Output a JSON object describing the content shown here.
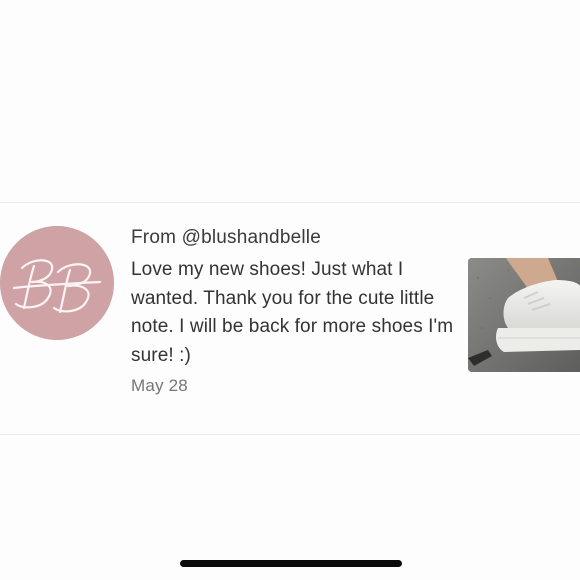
{
  "review": {
    "avatar_monogram": "BB",
    "author": "From @blushandbelle",
    "text": "Love my new shoes! Just what I wanted. Thank you for the cute little note. I will be back for more shoes I'm sure! :)",
    "date": "May 28"
  },
  "product_image": {
    "subject": "white platform sneaker"
  },
  "colors": {
    "avatar_bg": "#cfa2a6",
    "text_primary": "#333333",
    "text_secondary": "#757575",
    "divider": "#eaeaea",
    "home_indicator": "#0b0b0b"
  }
}
